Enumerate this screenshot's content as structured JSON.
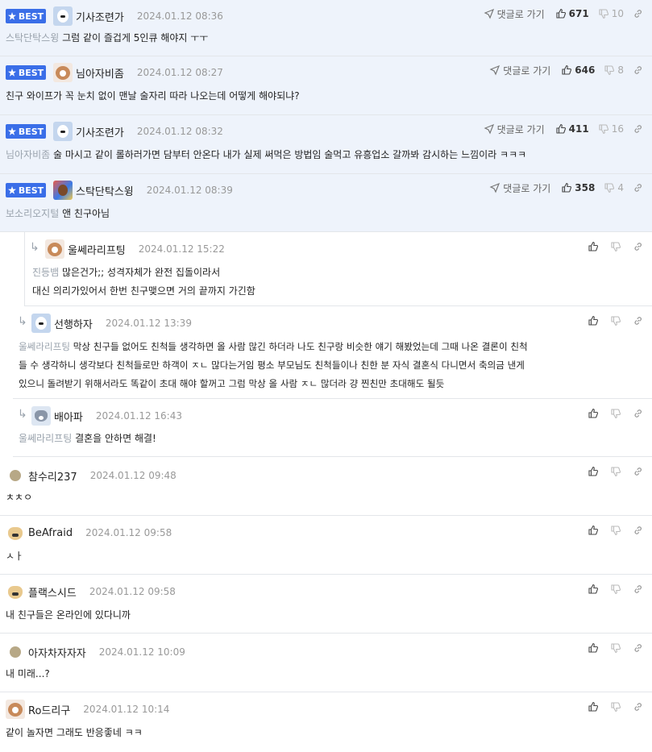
{
  "ui": {
    "best_label": "BEST",
    "goto_label": "댓글로 가기"
  },
  "best_comments": [
    {
      "name": "기사조련가",
      "date": "2024.01.12 08:36",
      "up": "671",
      "down": "10",
      "mention": "스탁단탁스윙",
      "text": "그럼 같이 즐겁게 5인큐 해야지 ㅜㅜ"
    },
    {
      "name": "님아자비좀",
      "date": "2024.01.12 08:27",
      "up": "646",
      "down": "8",
      "mention": "",
      "text": "친구 와이프가 꼭 눈치 없이 맨날 술자리 따라 나오는데 어떻게 해야되냐?"
    },
    {
      "name": "기사조련가",
      "date": "2024.01.12 08:32",
      "up": "411",
      "down": "16",
      "mention": "님아자비좀",
      "text": "술 마시고 같이 롤하러가면 담부터 안온다 내가 실제 써먹은 방법임 술먹고 유흥업소 갈까봐 감시하는 느낌이라 ㅋㅋㅋ"
    },
    {
      "name": "스탁단탁스윙",
      "date": "2024.01.12 08:39",
      "up": "358",
      "down": "4",
      "mention": "보소리오지털",
      "text": "앤 친구아님"
    }
  ],
  "replies": [
    {
      "name": "울쎄라리프팅",
      "date": "2024.01.12 15:22",
      "mention": "진등뱀",
      "lines": [
        "많은건가;; 성격자체가 완전 집돌이라서",
        "대신 의리가있어서 한번 친구맺으면 거의 끝까지 가긴함"
      ]
    },
    {
      "name": "선행하자",
      "date": "2024.01.12 13:39",
      "mention": "울쎄라리프팅",
      "lines": [
        "막상 친구들 없어도 친척들 생각하면 올 사람 많긴 하더라 나도 친구랑 비슷한 얘기 해봤었는데 그때 나온 결론이 친척",
        "들 수 생각하니 생각보다 친척들로만 하객이 ㅈㄴ 많다는거임 평소 부모님도 친척들이나 친한 분 자식 결혼식 다니면서 축의금 낸게",
        "있으니 돌려받기 위해서라도 똑같이 초대 해야 할꺼고 그럼 막상 올 사람 ㅈㄴ 많더라 걍 찐친만 초대해도 될듯"
      ]
    },
    {
      "name": "배아파",
      "date": "2024.01.12 16:43",
      "mention": "울쎄라리프팅",
      "lines": [
        "결혼을 안하면 해결!"
      ]
    }
  ],
  "comments": [
    {
      "name": "참수리237",
      "date": "2024.01.12 09:48",
      "text": "ㅊㅊㅇ"
    },
    {
      "name": "BeAfraid",
      "date": "2024.01.12 09:58",
      "text": "ㅅㅏ"
    },
    {
      "name": "플랙스시드",
      "date": "2024.01.12 09:58",
      "text": "내 친구들은 온라인에 있다니까"
    },
    {
      "name": "아자차자자자",
      "date": "2024.01.12 10:09",
      "text": "내 미래...?"
    },
    {
      "name": "Ro드리구",
      "date": "2024.01.12 10:14",
      "text": "같이 놀자면 그래도 반응좋네 ㅋㅋ"
    }
  ],
  "colors": {
    "best_bg": "#eef3fb",
    "badge": "#3a6ee8",
    "mention": "#9aa3ad"
  }
}
